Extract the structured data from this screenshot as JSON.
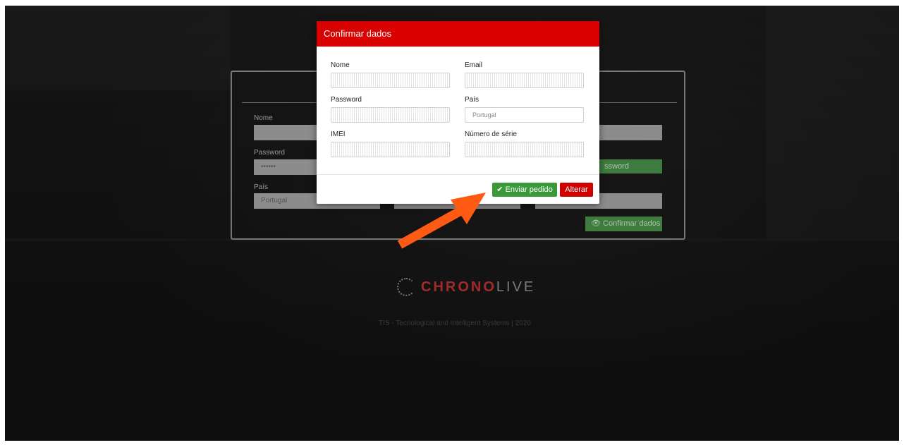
{
  "background_form": {
    "labels": [
      "Nome",
      "Password",
      "País"
    ],
    "password_mask": "••••••",
    "country_value": "Portugal",
    "password_button_label": "ssword",
    "confirm_button_label": "Confirmar dados"
  },
  "logo": {
    "text_part1": "CHRONO",
    "text_part2": "LIVE"
  },
  "footer": {
    "text": "TIS - Tecnological and Intelligent Systems | 2020"
  },
  "modal": {
    "title": "Confirmar dados",
    "fields": [
      {
        "label": "Nome",
        "value": "████████"
      },
      {
        "label": "Email",
        "value": "████████████"
      },
      {
        "label": "Password",
        "value": "████████████"
      },
      {
        "label": "País",
        "value": "Portugal"
      },
      {
        "label": "IMEI",
        "value": "██████████████"
      },
      {
        "label": "Número de série",
        "value": "████████████"
      }
    ],
    "send_button_label": "Enviar pedido",
    "edit_button_label": "Alterar"
  },
  "colors": {
    "header_red": "#d90000",
    "send_green": "#3a9a3a",
    "arrow_orange": "#ff5a14"
  }
}
